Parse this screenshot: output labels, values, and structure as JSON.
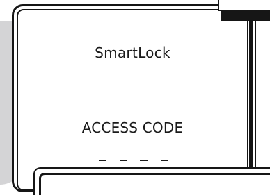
{
  "device": {
    "brand": "SmartLock",
    "prompt_label": "ACCESS CODE",
    "code_slots": [
      "",
      "",
      "",
      ""
    ],
    "code_length": 4
  },
  "colors": {
    "frame": "#161616",
    "background": "#ffffff",
    "shadow": "#d4d4d6",
    "text": "#1a1a1a"
  }
}
